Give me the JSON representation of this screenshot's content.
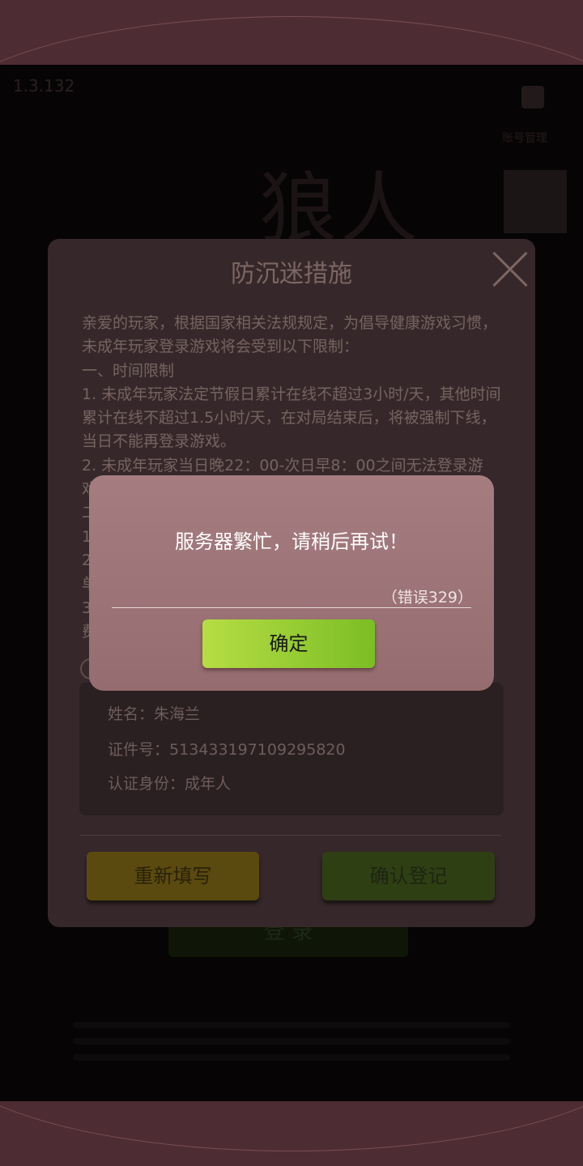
{
  "background": {
    "version": "1.3.132",
    "logo_text": "狼人杀",
    "account_label": "账号管理",
    "login_label": "登 录"
  },
  "modal": {
    "title": "防沉迷措施",
    "intro": "亲爱的玩家，根据国家相关法规规定，为倡导健康游戏习惯，未成年玩家登录游戏将会受到以下限制：",
    "section1": "一、时间限制",
    "rule1": "1. 未成年玩家法定节假日累计在线不超过3小时/天，其他时间累计在线不超过1.5小时/天，在对局结束后，将被强制下线，当日不能再登录游戏。",
    "rule2": "2. 未成年玩家当日晚22：00-次日早8：00之间无法登录游",
    "rule2_tail": "戏。",
    "frag_a": "二",
    "frag_b": "1",
    "frag_c": "2",
    "frag_d": "单",
    "frag_e": "3",
    "frag_f": "费",
    "info": {
      "name_label": "姓名：",
      "name_value": "朱海兰",
      "id_label": "证件号：",
      "id_value": "513433197109295820",
      "identity_label": "认证身份：",
      "identity_value": "成年人"
    },
    "refill_button": "重新填写",
    "confirm_register_button": "确认登记"
  },
  "alert": {
    "message": "服务器繁忙，请稍后再试！",
    "error_code": "（错误329）",
    "ok_button": "确定"
  }
}
